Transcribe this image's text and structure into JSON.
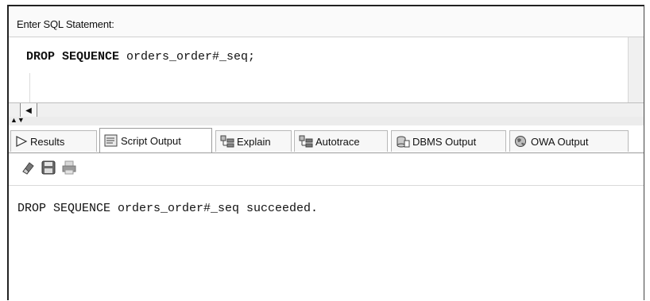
{
  "sql_panel": {
    "label": "Enter SQL Statement:",
    "statement_keyword": "DROP SEQUENCE",
    "statement_rest": " orders_order#_seq;"
  },
  "tabs": [
    {
      "label": "Results",
      "icon": "play-arrow-icon",
      "active": false
    },
    {
      "label": "Script Output",
      "icon": "script-output-icon",
      "active": true
    },
    {
      "label": "Explain",
      "icon": "explain-plan-icon",
      "active": false
    },
    {
      "label": "Autotrace",
      "icon": "autotrace-icon",
      "active": false
    },
    {
      "label": "DBMS Output",
      "icon": "dbms-output-icon",
      "active": false
    },
    {
      "label": "OWA Output",
      "icon": "owa-globe-icon",
      "active": false
    }
  ],
  "toolbar": {
    "icons": [
      "eraser-icon",
      "save-icon",
      "print-icon"
    ]
  },
  "output": {
    "text": "DROP SEQUENCE orders_order#_seq succeeded."
  },
  "colors": {
    "border": "#222222",
    "tab_border": "#b8b8b8",
    "panel_bg": "#f0f0f0"
  }
}
